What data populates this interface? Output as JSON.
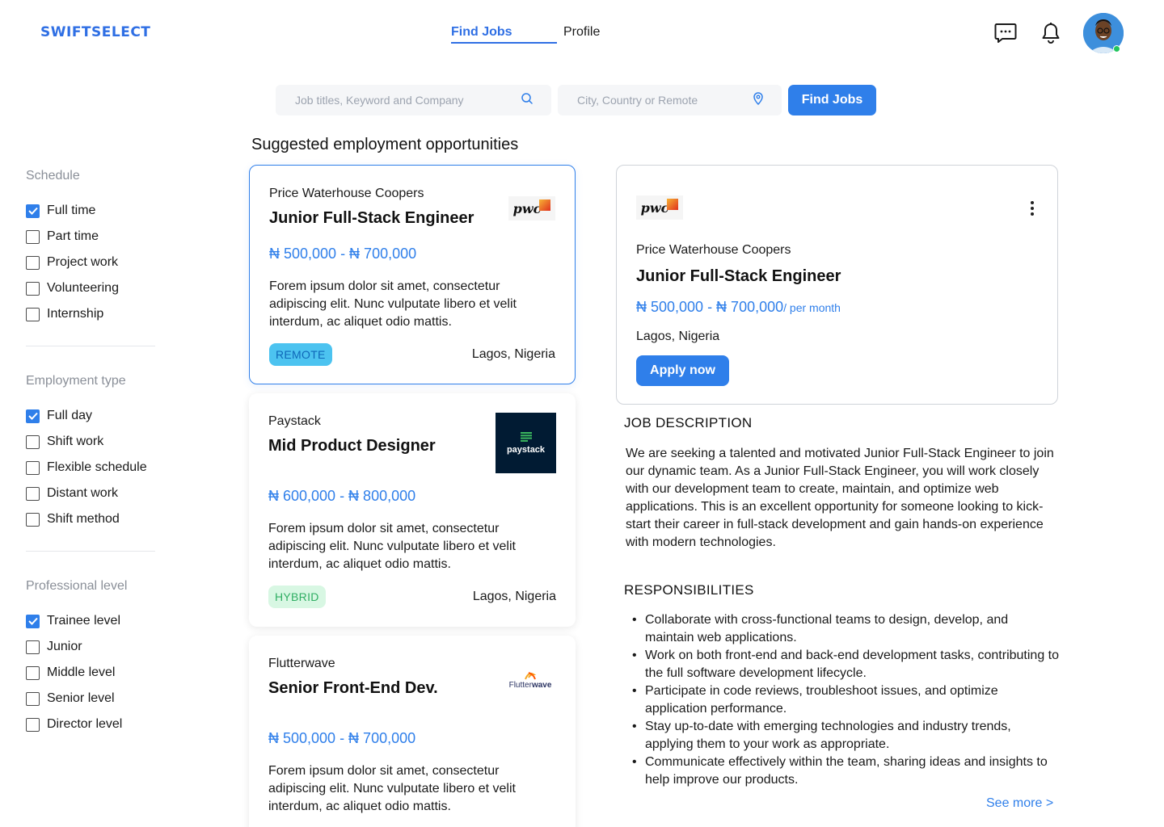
{
  "brand": {
    "name": "SWIFTSELECT",
    "accent": "#2f7fea"
  },
  "nav": {
    "find_jobs": "Find Jobs",
    "profile": "Profile"
  },
  "header_icons": [
    "chat-icon",
    "bell-icon",
    "avatar"
  ],
  "search": {
    "keyword_placeholder": "Job titles, Keyword and Company",
    "location_placeholder": "City, Country or Remote",
    "button_label": "Find Jobs"
  },
  "section_title": "Suggested employment opportunities",
  "filters": [
    {
      "heading": "Schedule",
      "items": [
        {
          "label": "Full time",
          "checked": true
        },
        {
          "label": "Part time",
          "checked": false
        },
        {
          "label": "Project work",
          "checked": false
        },
        {
          "label": "Volunteering",
          "checked": false
        },
        {
          "label": "Internship",
          "checked": false
        }
      ]
    },
    {
      "heading": "Employment type",
      "items": [
        {
          "label": "Full day",
          "checked": true
        },
        {
          "label": "Shift work",
          "checked": false
        },
        {
          "label": "Flexible schedule",
          "checked": false
        },
        {
          "label": "Distant work",
          "checked": false
        },
        {
          "label": "Shift method",
          "checked": false
        }
      ]
    },
    {
      "heading": "Professional level",
      "items": [
        {
          "label": "Trainee level",
          "checked": true
        },
        {
          "label": "Junior",
          "checked": false
        },
        {
          "label": "Middle level",
          "checked": false
        },
        {
          "label": "Senior level",
          "checked": false
        },
        {
          "label": "Director level",
          "checked": false
        }
      ]
    }
  ],
  "jobs": [
    {
      "company": "Price Waterhouse Coopers",
      "title": "Junior Full-Stack Engineer",
      "salary": "₦ 500,000 - ₦ 700,000",
      "description": "Forem ipsum dolor sit amet, consectetur adipiscing elit. Nunc vulputate libero et velit interdum, ac aliquet odio mattis.",
      "tag": "REMOTE",
      "location": "Lagos, Nigeria",
      "logo_text": "pwc"
    },
    {
      "company": "Paystack",
      "title": "Mid Product Designer",
      "salary": "₦ 600,000 - ₦ 800,000",
      "description": "Forem ipsum dolor sit amet, consectetur adipiscing elit. Nunc vulputate libero et velit interdum, ac aliquet odio mattis.",
      "tag": "HYBRID",
      "location": "Lagos, Nigeria",
      "logo_text": "paystack"
    },
    {
      "company": "Flutterwave",
      "title": "Senior Front-End Dev.",
      "salary": "₦ 500,000 - ₦ 700,000",
      "description": "Forem ipsum dolor sit amet, consectetur adipiscing elit. Nunc vulputate libero et velit interdum, ac aliquet odio mattis.",
      "logo_text_a": "Flutter",
      "logo_text_b": "wave"
    }
  ],
  "detail": {
    "logo_text": "pwc",
    "company": "Price Waterhouse Coopers",
    "title": "Junior Full-Stack Engineer",
    "salary": "₦ 500,000 - ₦ 700,000",
    "salary_period": "/ per month",
    "location": "Lagos, Nigeria",
    "apply_label": "Apply now",
    "jd_heading": "JOB DESCRIPTION",
    "jd_text": "We are seeking a talented and motivated Junior Full-Stack Engineer to join our dynamic team. As a Junior Full-Stack Engineer, you will work closely with our development team to create, maintain, and optimize web applications. This is an excellent opportunity for someone looking to kick-start their career in full-stack development and gain hands-on experience with modern technologies.",
    "resp_heading": "RESPONSIBILITIES",
    "responsibilities": [
      "Collaborate with cross-functional teams to design, develop, and maintain web applications.",
      "Work on both front-end and back-end development tasks, contributing to the full software development lifecycle.",
      "Participate in code reviews, troubleshoot issues, and optimize application performance.",
      "Stay up-to-date with emerging technologies and industry trends, applying them to your work as appropriate.",
      "Communicate effectively within the team, sharing ideas and insights to help improve our products."
    ],
    "see_more": "See more >"
  }
}
